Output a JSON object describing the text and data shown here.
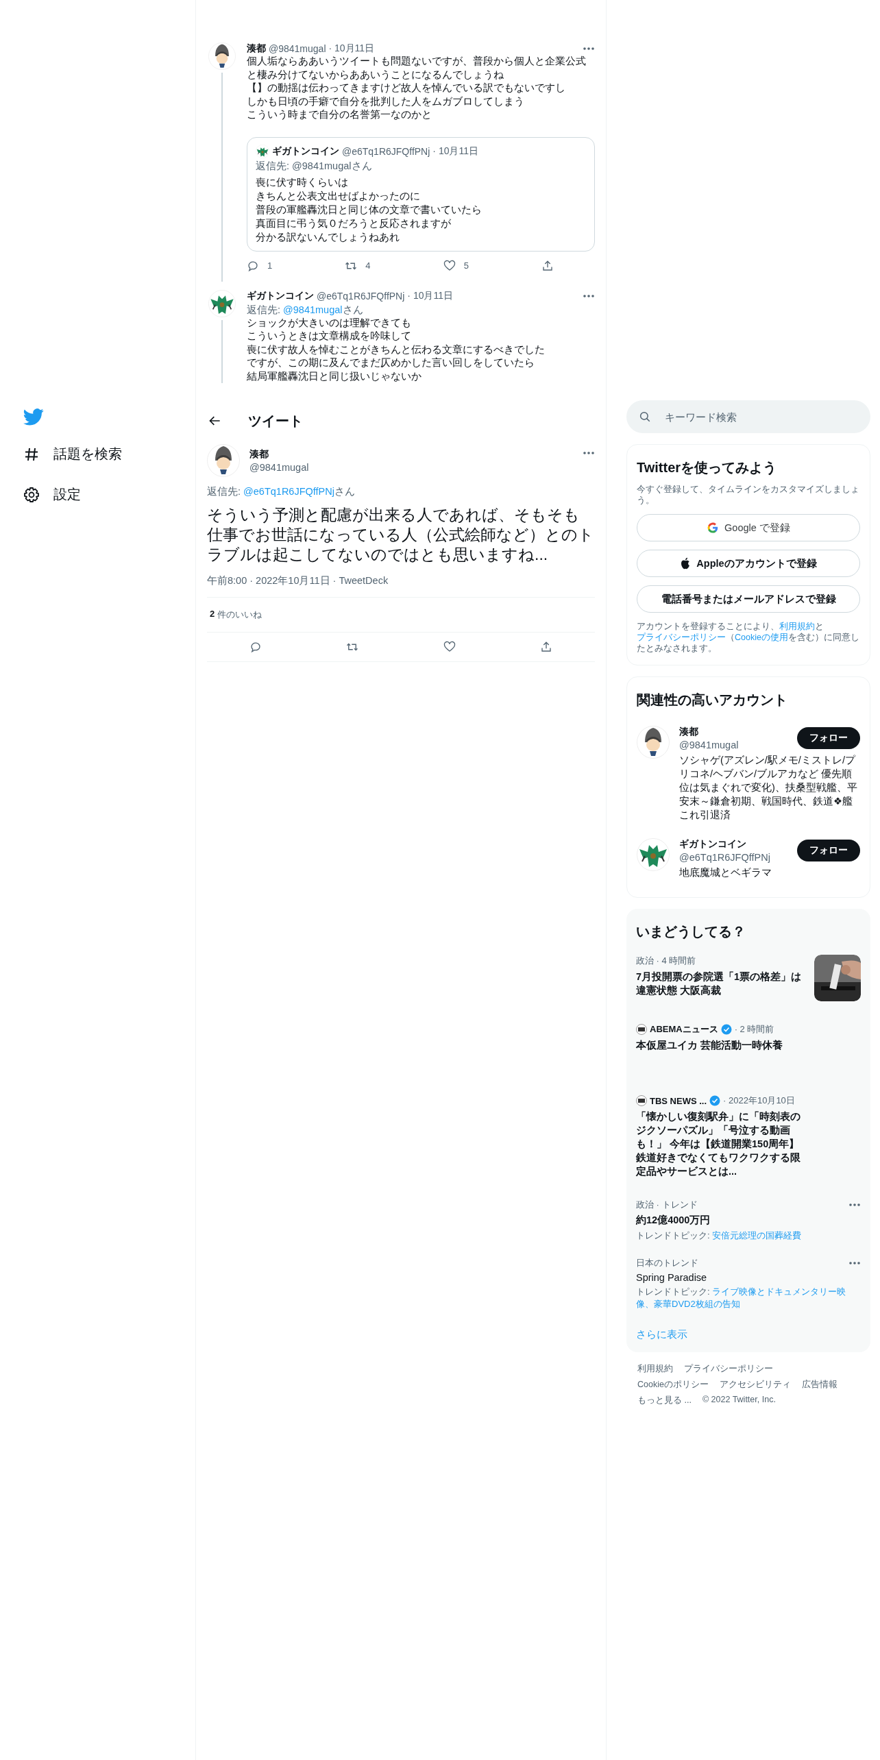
{
  "sidebar": {
    "items": [
      {
        "kind": "hashtag",
        "label": "話題を検索"
      },
      {
        "kind": "settings",
        "label": "設定"
      }
    ]
  },
  "thread": [
    {
      "avatar": {
        "kind": "person"
      },
      "name": "湊都",
      "handle": "@9841mugal",
      "date": "· 10月11日",
      "lines": [
        "個人垢ならああいうツイートも問題ないですが、普段から個人と企業公式と棲み分けてないからああいうことになるんでしょうね",
        "【】の動揺は伝わってきますけど故人を悼んでいる訳でもないですし",
        "しかも日頃の手癖で自分を批判した人をムガブロしてしまう",
        "こういう時まで自分の名誉第一なのかと"
      ],
      "quote": {
        "avatar": {
          "kind": "dragon"
        },
        "name": "ギガトンコイン",
        "handle": "@e6Tq1R6JFQffPNj",
        "date": "· 10月11日",
        "reply_to": {
          "label": "返信先:",
          "handle": "@9841mugal",
          "suffix": "さん",
          "linked": false
        },
        "lines": [
          "喪に伏す時くらいは",
          "きちんと公表文出せばよかったのに",
          "普段の軍艦轟沈日と同じ体の文章で書いていたら",
          "真面目に弔う気０だろうと反応されますが",
          "分かる訳ないんでしょうねあれ"
        ]
      },
      "actions": [
        {
          "kind": "reply",
          "count": "1"
        },
        {
          "kind": "retweet",
          "count": "4"
        },
        {
          "kind": "like",
          "count": "5"
        },
        {
          "kind": "share"
        }
      ]
    },
    {
      "avatar": {
        "kind": "dragon"
      },
      "name": "ギガトンコイン",
      "handle": "@e6Tq1R6JFQffPNj",
      "date": "· 10月11日",
      "reply_to": {
        "label": "返信先:",
        "handle": "@9841mugal",
        "suffix": "さん",
        "linked": true
      },
      "lines": [
        "ショックが大きいのは理解できても",
        "こういうときは文章構成を吟味して",
        "喪に伏す故人を悼むことがきちんと伝わる文章にするべきでした",
        "ですが、この期に及んでまだ仄めかした言い回しをしていたら",
        "結局軍艦轟沈日と同じ扱いじゃないか"
      ]
    }
  ],
  "header": {
    "title": "ツイート"
  },
  "main_tweet": {
    "avatar": {
      "kind": "person"
    },
    "name": "湊都",
    "handle": "@9841mugal",
    "reply_to": {
      "label": "返信先:",
      "handle": "@e6Tq1R6JFQffPNj",
      "suffix": "さん",
      "linked": true
    },
    "text": "そういう予測と配慮が出来る人であれば、そもそも仕事でお世話になっている人（公式絵師など）とのトラブルは起こしてないのではとも思いますね...",
    "meta": "午前8:00 · 2022年10月11日 · TweetDeck",
    "likes_count": "2",
    "likes_label": "件のいいね",
    "actions": [
      {
        "kind": "reply"
      },
      {
        "kind": "retweet"
      },
      {
        "kind": "like"
      },
      {
        "kind": "share"
      }
    ]
  },
  "search": {
    "placeholder": "キーワード検索"
  },
  "signup": {
    "title": "Twitterを使ってみよう",
    "description": "今すぐ登録して、タイムラインをカスタマイズしましょう。",
    "buttons": [
      {
        "kind": "google",
        "label": "Google で登録"
      },
      {
        "kind": "apple",
        "label": "Appleのアカウントで登録"
      },
      {
        "kind": "plain",
        "label": "電話番号またはメールアドレスで登録"
      }
    ],
    "terms": [
      {
        "text": "アカウントを登録することにより、",
        "link": false
      },
      {
        "text": "利用規約",
        "link": true
      },
      {
        "text": "と",
        "link": false
      },
      {
        "text": "プライバシーポリシー",
        "link": true
      },
      {
        "text": "（",
        "link": false
      },
      {
        "text": "Cookieの使用",
        "link": true
      },
      {
        "text": "を含む）に同意したとみなされます。",
        "link": false
      }
    ]
  },
  "related": {
    "title": "関連性の高いアカウント",
    "accounts": [
      {
        "avatar": {
          "kind": "person"
        },
        "name": "湊都",
        "handle": "@9841mugal",
        "bio": "ソシャゲ(アズレン/駅メモ/ミストレ/プリコネ/ヘブバン/ブルアカなど 優先順位は気まぐれで変化)、扶桑型戦艦、平安末～鎌倉初期、戦国時代、鉄道❖艦これ引退済",
        "button": "フォロー"
      },
      {
        "avatar": {
          "kind": "dragon"
        },
        "name": "ギガトンコイン",
        "handle": "@e6Tq1R6JFQffPNj",
        "bio": "地底魔城とベギラマ",
        "button": "フォロー"
      }
    ]
  },
  "trends": {
    "title": "いまどうしてる？",
    "items": [
      {
        "kind": "news",
        "meta": "政治 · 4 時間前",
        "headline": "7月投開票の参院選「1票の格差」は違憲状態 大阪高裁",
        "picture": true
      },
      {
        "kind": "news",
        "source": "ABEMAニュース",
        "verified": true,
        "meta": "· 2 時間前",
        "headline": "本仮屋ユイカ 芸能活動一時休養",
        "picture": false
      },
      {
        "kind": "news",
        "source": "TBS NEWS ...",
        "verified": true,
        "meta": "· 2022年10月10日",
        "headline": "「懐かしい復刻駅弁」に「時刻表のジクソーパズル」「号泣する動画も！」 今年は【鉄道開業150周年】鉄道好きでなくてもワクワクする限定品やサービスとは...",
        "picture": false
      },
      {
        "kind": "trend",
        "context": "政治 · トレンド",
        "title": "約12億4000万円",
        "topic_label": "トレンドトピック:",
        "topic": "安倍元総理の国葬経費"
      },
      {
        "kind": "trend",
        "context": "日本のトレンド",
        "title": "Spring Paradise",
        "topic_label": "トレンドトピック:",
        "topic": "ライブ映像とドキュメンタリー映像、豪華DVD2枚組の告知"
      }
    ],
    "more": "さらに表示"
  },
  "footer": {
    "links": [
      "利用規約",
      "プライバシーポリシー",
      "Cookieのポリシー",
      "アクセシビリティ",
      "広告情報",
      "もっと見る ..."
    ],
    "copyright": "© 2022 Twitter, Inc."
  }
}
